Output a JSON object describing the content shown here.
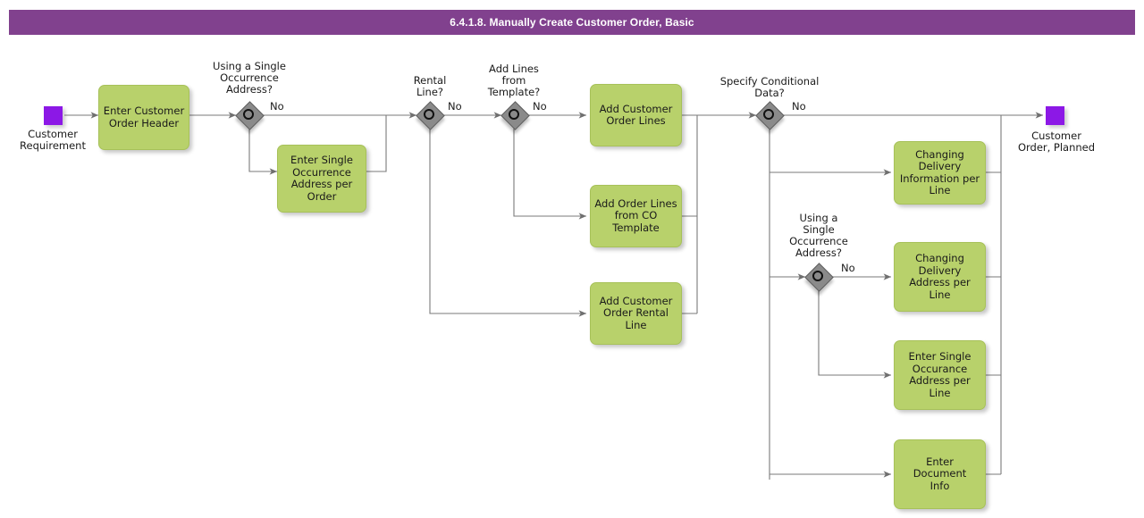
{
  "header": {
    "title": "6.4.1.8. Manually Create Customer Order, Basic",
    "bar_color": "#81418e",
    "text_color": "#ffffff"
  },
  "theme": {
    "task_fill": "#b8d16b",
    "task_stroke": "#a7c159",
    "gateway_fill": "#8a8a8a",
    "event_fill": "#8c18e6",
    "connector": "#7a7a7a"
  },
  "events": [
    {
      "id": "start",
      "label": "Customer\nRequirement"
    },
    {
      "id": "end",
      "label": "Customer\nOrder, Planned"
    }
  ],
  "gateways": [
    {
      "id": "gw-single-occurrence-order",
      "label": "Using a Single\nOccurrence\nAddress?",
      "branch_label": "No"
    },
    {
      "id": "gw-rental-line",
      "label": "Rental\nLine?",
      "branch_label": "No"
    },
    {
      "id": "gw-add-lines-template",
      "label": "Add Lines\nfrom\nTemplate?",
      "branch_label": "No"
    },
    {
      "id": "gw-specify-conditional-data",
      "label": "Specify Conditional\nData?",
      "branch_label": "No"
    },
    {
      "id": "gw-single-occurrence-line",
      "label": "Using a\nSingle\nOccurrence\nAddress?",
      "branch_label": "No"
    }
  ],
  "tasks": [
    {
      "id": "enter-customer-order-header",
      "label": "Enter Customer\nOrder Header"
    },
    {
      "id": "enter-single-occurrence-address-per-order",
      "label": "Enter Single\nOccurrence\nAddress per\nOrder"
    },
    {
      "id": "add-customer-order-lines",
      "label": "Add Customer\nOrder Lines"
    },
    {
      "id": "add-order-lines-from-co-template",
      "label": "Add Order Lines\nfrom CO\nTemplate"
    },
    {
      "id": "add-customer-order-rental-line",
      "label": "Add Customer\nOrder Rental\nLine"
    },
    {
      "id": "changing-delivery-information-per-line",
      "label": "Changing\nDelivery\nInformation per\nLine"
    },
    {
      "id": "changing-delivery-address-per-line",
      "label": "Changing\nDelivery\nAddress per Line"
    },
    {
      "id": "enter-single-occurance-address-per-line",
      "label": "Enter Single\nOccurance\nAddress per Line"
    },
    {
      "id": "enter-document-info",
      "label": "Enter Document\nInfo"
    }
  ]
}
